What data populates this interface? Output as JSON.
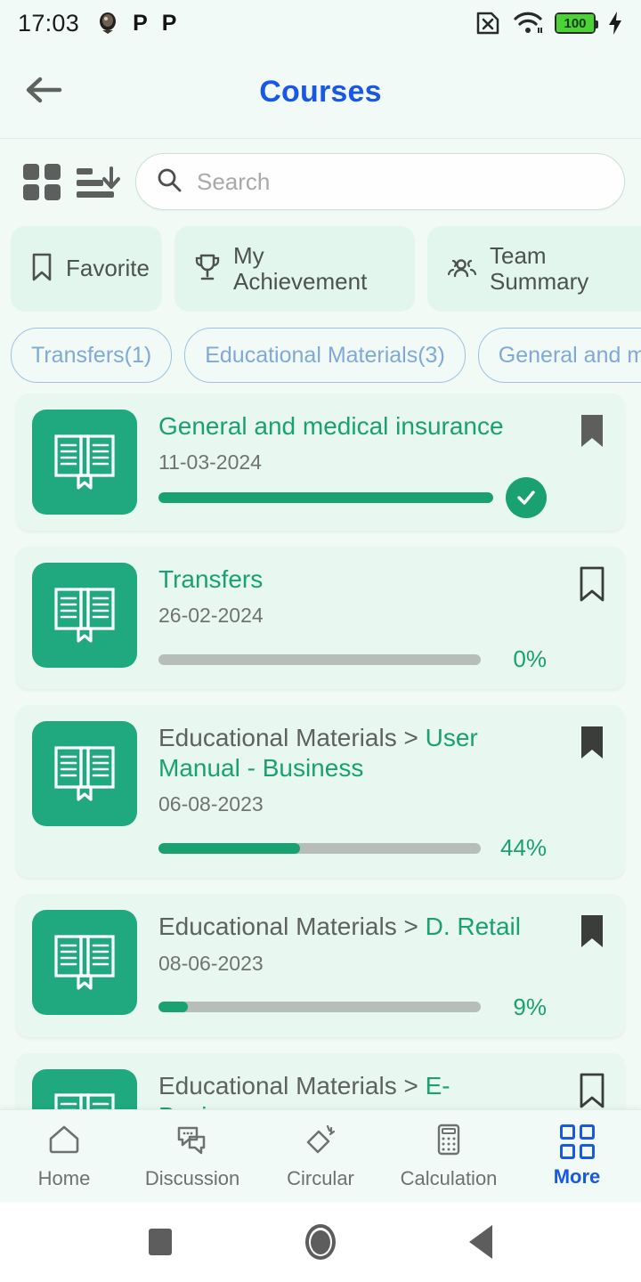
{
  "status_bar": {
    "time": "17:03",
    "left_icons": [
      "app-badge-icon",
      "p-app-icon",
      "p-app-icon"
    ],
    "right_icons": [
      "no-sim-icon",
      "wifi-icon",
      "battery-icon",
      "charging-bolt-icon"
    ],
    "battery_level": "100"
  },
  "header": {
    "back_icon": "back-arrow-icon",
    "title": "Courses",
    "title_color": "#1858e8"
  },
  "toolbar": {
    "grid_icon": "grid-view-icon",
    "sort_icon": "sort-descending-icon",
    "search": {
      "icon": "search-icon",
      "value": "",
      "placeholder": "Search"
    }
  },
  "quick_tiles": [
    {
      "label": "Favorite",
      "icon": "bookmark-icon"
    },
    {
      "label": "My Achievement",
      "icon": "trophy-icon"
    },
    {
      "label": "Team Summary",
      "icon": "team-people-icon"
    }
  ],
  "filter_chips": [
    {
      "label": "Transfers(1)"
    },
    {
      "label": "Educational Materials(3)"
    },
    {
      "label": "General and medic"
    }
  ],
  "colors": {
    "accent_green": "#1aa172",
    "thumb_green": "#20a97f",
    "card_bg": "#e8f8f1",
    "page_bg": "#f1faf6",
    "chip_border": "#9cc2e8",
    "chip_text": "#7fa9d8",
    "brand_blue": "#1858e8",
    "track_gray": "#b7bdb9"
  },
  "courses": [
    {
      "crumb": "",
      "title": "General and medical insurance",
      "date": "11-03-2024",
      "progress": 100,
      "progress_label": "",
      "completed": true,
      "bookmarked": true,
      "thumb_icon": "open-book-icon"
    },
    {
      "crumb": "",
      "title": "Transfers",
      "date": "26-02-2024",
      "progress": 0,
      "progress_label": "0%",
      "completed": false,
      "bookmarked": false,
      "thumb_icon": "open-book-icon"
    },
    {
      "crumb": "Educational Materials > ",
      "title": "User Manual - Business",
      "date": "06-08-2023",
      "progress": 44,
      "progress_label": "44%",
      "completed": false,
      "bookmarked": true,
      "thumb_icon": "open-book-icon"
    },
    {
      "crumb": "Educational Materials > ",
      "title": "D. Retail",
      "date": "08-06-2023",
      "progress": 9,
      "progress_label": "9%",
      "completed": false,
      "bookmarked": true,
      "thumb_icon": "open-book-icon"
    },
    {
      "crumb": "Educational Materials > ",
      "title": "E-Business",
      "date": "",
      "progress": 0,
      "progress_label": "",
      "completed": false,
      "bookmarked": false,
      "thumb_icon": "open-book-icon"
    }
  ],
  "bottom_nav": {
    "active": "More",
    "items": [
      {
        "label": "Home",
        "icon": "home-icon"
      },
      {
        "label": "Discussion",
        "icon": "chat-bubbles-icon"
      },
      {
        "label": "Circular",
        "icon": "megaphone-icon"
      },
      {
        "label": "Calculation",
        "icon": "calculator-icon"
      },
      {
        "label": "More",
        "icon": "grid-more-icon"
      }
    ]
  },
  "system_bar": {
    "recents_icon": "square-recents-icon",
    "home_icon": "circle-home-icon",
    "back_icon": "triangle-back-icon"
  }
}
